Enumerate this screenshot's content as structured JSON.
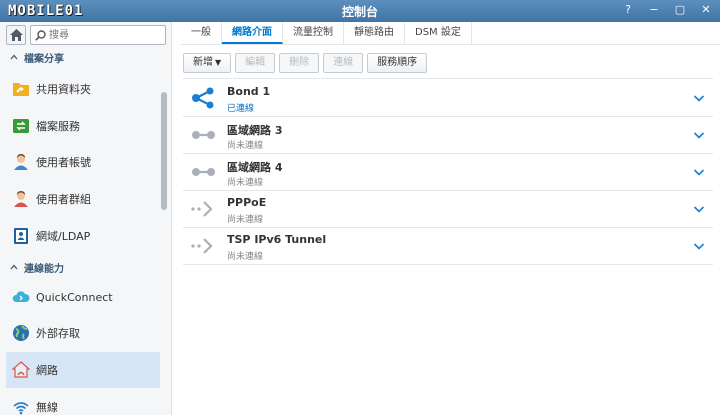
{
  "titlebar": {
    "logo": "MOBILE01",
    "title": "控制台",
    "buttons": [
      {
        "name": "help",
        "glyph": "?"
      },
      {
        "name": "minimize",
        "glyph": "−"
      },
      {
        "name": "maximize",
        "glyph": "▢"
      },
      {
        "name": "close",
        "glyph": "✕"
      }
    ]
  },
  "sidebar": {
    "search": {
      "placeholder": "搜尋"
    },
    "sections": [
      {
        "label": "檔案分享",
        "items": [
          {
            "label": "共用資料夾",
            "icon": "shared-folder-icon"
          },
          {
            "label": "檔案服務",
            "icon": "file-services-icon"
          },
          {
            "label": "使用者帳號",
            "icon": "user-icon"
          },
          {
            "label": "使用者群組",
            "icon": "group-icon"
          },
          {
            "label": "網域/LDAP",
            "icon": "domain-ldap-icon"
          }
        ]
      },
      {
        "label": "連線能力",
        "items": [
          {
            "label": "QuickConnect",
            "icon": "quickconnect-cloud-icon"
          },
          {
            "label": "外部存取",
            "icon": "external-access-globe-icon"
          },
          {
            "label": "網路",
            "icon": "network-house-icon",
            "active": true
          },
          {
            "label": "無線",
            "icon": "wireless-icon"
          }
        ]
      }
    ]
  },
  "main": {
    "tabs": [
      {
        "label": "一般",
        "active": false
      },
      {
        "label": "網路介面",
        "active": true
      },
      {
        "label": "流量控制",
        "active": false
      },
      {
        "label": "靜態路由",
        "active": false
      },
      {
        "label": "DSM 設定",
        "active": false
      }
    ],
    "toolbar": {
      "create": "新增",
      "edit": "編輯",
      "delete": "刪除",
      "connect": "連線",
      "service_order": "服務順序"
    },
    "interfaces": [
      {
        "name": "Bond 1",
        "status": "已連線",
        "connected": true,
        "icon": "bond-share-icon"
      },
      {
        "name": "區域網路 3",
        "status": "尚未連線",
        "connected": false,
        "icon": "lan-icon"
      },
      {
        "name": "區域網路 4",
        "status": "尚未連線",
        "connected": false,
        "icon": "lan-icon"
      },
      {
        "name": "PPPoE",
        "status": "尚未連線",
        "connected": false,
        "icon": "pppoe-arrow-icon"
      },
      {
        "name": "TSP IPv6 Tunnel",
        "status": "尚未連線",
        "connected": false,
        "icon": "tunnel-arrow-icon"
      }
    ]
  },
  "colors": {
    "titlebar": "#4a80b2",
    "accent": "#0079d0",
    "active_item_bg": "#d6e6f5",
    "connected_icon": "#1a7fd1",
    "disconnected_icon": "#a9b0b7"
  }
}
